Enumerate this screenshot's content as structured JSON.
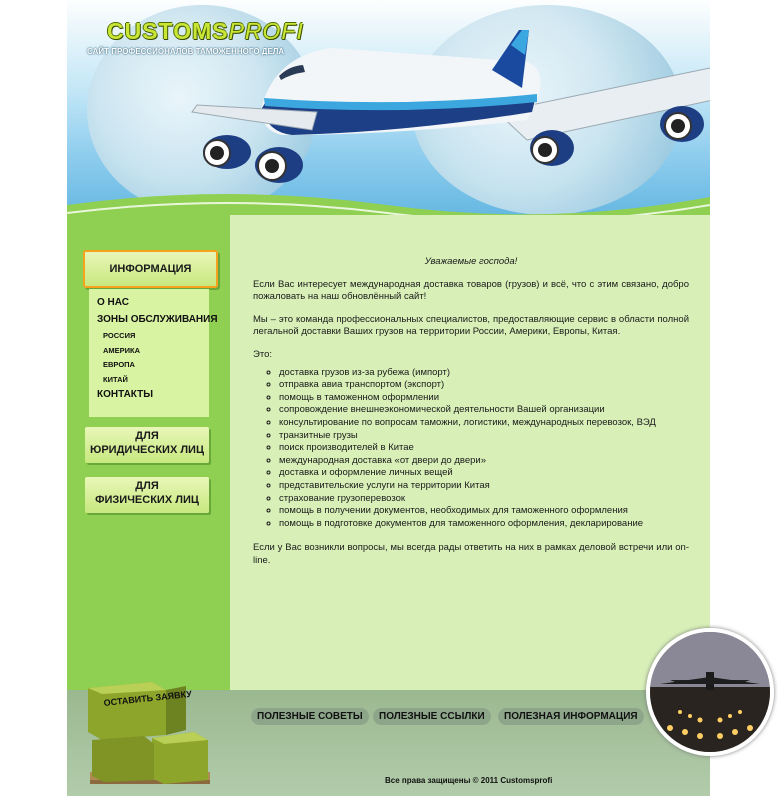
{
  "brand": {
    "logo_bold": "CUSTOMS",
    "logo_light": "PROFI",
    "tagline": "САЙТ ПРОФЕССИОНАЛОВ ТАМОЖЕННОГО ДЕЛА"
  },
  "sidebar": {
    "info_tab": "ИНФОРМАЦИЯ",
    "menu": {
      "about": "О НАС",
      "zones": "ЗОНЫ ОБСЛУЖИВАНИЯ",
      "zone_items": [
        "РОССИЯ",
        "АМЕРИКА",
        "ЕВРОПА",
        "КИТАЙ"
      ],
      "selected": "ЕВРОПА",
      "contacts": "КОНТАКТЫ"
    },
    "legal_tab": {
      "line1": "ДЛЯ",
      "line2": "ЮРИДИЧЕСКИХ ЛИЦ"
    },
    "phys_tab": {
      "line1": "ДЛЯ",
      "line2": "ФИЗИЧЕСКИХ ЛИЦ"
    }
  },
  "content": {
    "greeting": "Уважаемые господа!",
    "p1": "Если Вас интересует международная доставка товаров (грузов) и всё, что с этим связано, добро пожаловать на наш обновлённый сайт!",
    "p2": "Мы – это команда профессиональных специалистов, предоставляющие сервис в области полной легальной доставки Ваших грузов на территории России, Америки, Европы, Китая.",
    "list_intro": "Это:",
    "services": [
      "доставка грузов из-за рубежа (импорт)",
      "отправка авиа транспортом (экспорт)",
      "помощь в таможенном оформлении",
      "сопровождение внешнеэкономической деятельности Вашей организации",
      "консультирование по вопросам таможни, логистики, международных перевозок, ВЭД",
      "транзитные грузы",
      "поиск производителей в Китае",
      "международная доставка «от двери до двери»",
      "доставка и оформление личных вещей",
      "представительские услуги на территории Китая",
      "страхование грузоперевозок",
      "помощь в получении документов, необходимых для таможенного оформления",
      "помощь в подготовке документов для таможенного оформления, декларирование"
    ],
    "p3": "Если у Вас возникли вопросы, мы всегда рады ответить на них в рамках деловой встречи или on-line."
  },
  "footer": {
    "links": [
      "ПОЛЕЗНЫЕ СОВЕТЫ",
      "ПОЛЕЗНЫЕ ССЫЛКИ",
      "ПОЛЕЗНАЯ ИНФОРМАЦИЯ"
    ],
    "copyright": "Все права защищены © 2011 Customsprofi",
    "box_label": "ОСТАВИТЬ ЗАЯВКУ"
  },
  "colors": {
    "sidebar": "#8fd052",
    "content_bg": "#d8f0b8",
    "accent_orange": "#f7a21c",
    "sky": "#8fcdee"
  }
}
